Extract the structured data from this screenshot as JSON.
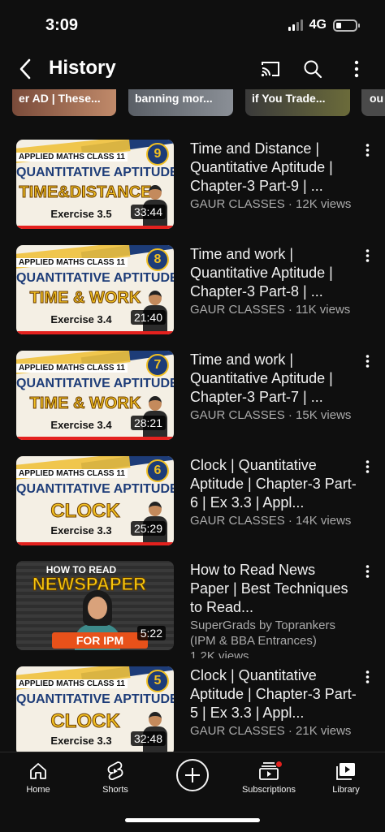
{
  "status": {
    "time": "3:09",
    "network": "4G"
  },
  "header": {
    "title": "History"
  },
  "shorts": [
    {
      "label": "er AD | These..."
    },
    {
      "label": "banning mor..."
    },
    {
      "label": "if You Trade..."
    },
    {
      "label": "ou"
    }
  ],
  "videos": [
    {
      "title": "Time and Distance | Quantitative Aptitude | Chapter-3 Part-9 | ...",
      "channel": "GAUR CLASSES · 12K views",
      "duration": "33:44",
      "thumb": {
        "class_label": "APPLIED MATHS CLASS 11",
        "subject": "QUANTITATIVE APTITUDE",
        "topic": "TIME&DISTANCE",
        "exercise": "Exercise 3.5",
        "number": "9"
      }
    },
    {
      "title": "Time and work | Quantitative Aptitude | Chapter-3 Part-8 | ...",
      "channel": "GAUR CLASSES · 11K views",
      "duration": "21:40",
      "thumb": {
        "class_label": "APPLIED MATHS CLASS 11",
        "subject": "QUANTITATIVE APTITUDE",
        "topic": "TIME & WORK",
        "exercise": "Exercise 3.4",
        "number": "8"
      }
    },
    {
      "title": "Time and work | Quantitative Aptitude | Chapter-3 Part-7 | ...",
      "channel": "GAUR CLASSES · 15K views",
      "duration": "28:21",
      "thumb": {
        "class_label": "APPLIED MATHS CLASS 11",
        "subject": "QUANTITATIVE APTITUDE",
        "topic": "TIME & WORK",
        "exercise": "Exercise 3.4",
        "number": "7"
      }
    },
    {
      "title": "Clock | Quantitative Aptitude | Chapter-3 Part-6 | Ex 3.3 | Appl...",
      "channel": "GAUR CLASSES · 14K views",
      "duration": "25:29",
      "thumb": {
        "class_label": "APPLIED MATHS CLASS 11",
        "subject": "QUANTITATIVE APTITUDE",
        "topic": "CLOCK",
        "exercise": "Exercise 3.3",
        "number": "6"
      }
    },
    {
      "title": "How to Read News Paper | Best Techniques to Read...",
      "channel": "SuperGrads by Toprankers (IPM & BBA Entrances)",
      "extra": "1.2K views",
      "duration": "5:22",
      "thumb": {
        "howto": "HOW TO READ",
        "headline": "NEWSPAPER",
        "banner": "FOR IPM"
      }
    },
    {
      "title": "Clock | Quantitative Aptitude | Chapter-3 Part-5 | Ex 3.3 | Appl...",
      "channel": "GAUR CLASSES · 21K views",
      "duration": "32:48",
      "thumb": {
        "class_label": "APPLIED MATHS CLASS 11",
        "subject": "QUANTITATIVE APTITUDE",
        "topic": "CLOCK",
        "exercise": "Exercise 3.3",
        "number": "5"
      }
    }
  ],
  "nav": {
    "home": "Home",
    "shorts": "Shorts",
    "subscriptions": "Subscriptions",
    "library": "Library"
  },
  "colors": {
    "background": "#0f0f0f",
    "text": "#f1f1f1",
    "secondary": "#aaaaaa",
    "accent_red": "#e3211e"
  }
}
